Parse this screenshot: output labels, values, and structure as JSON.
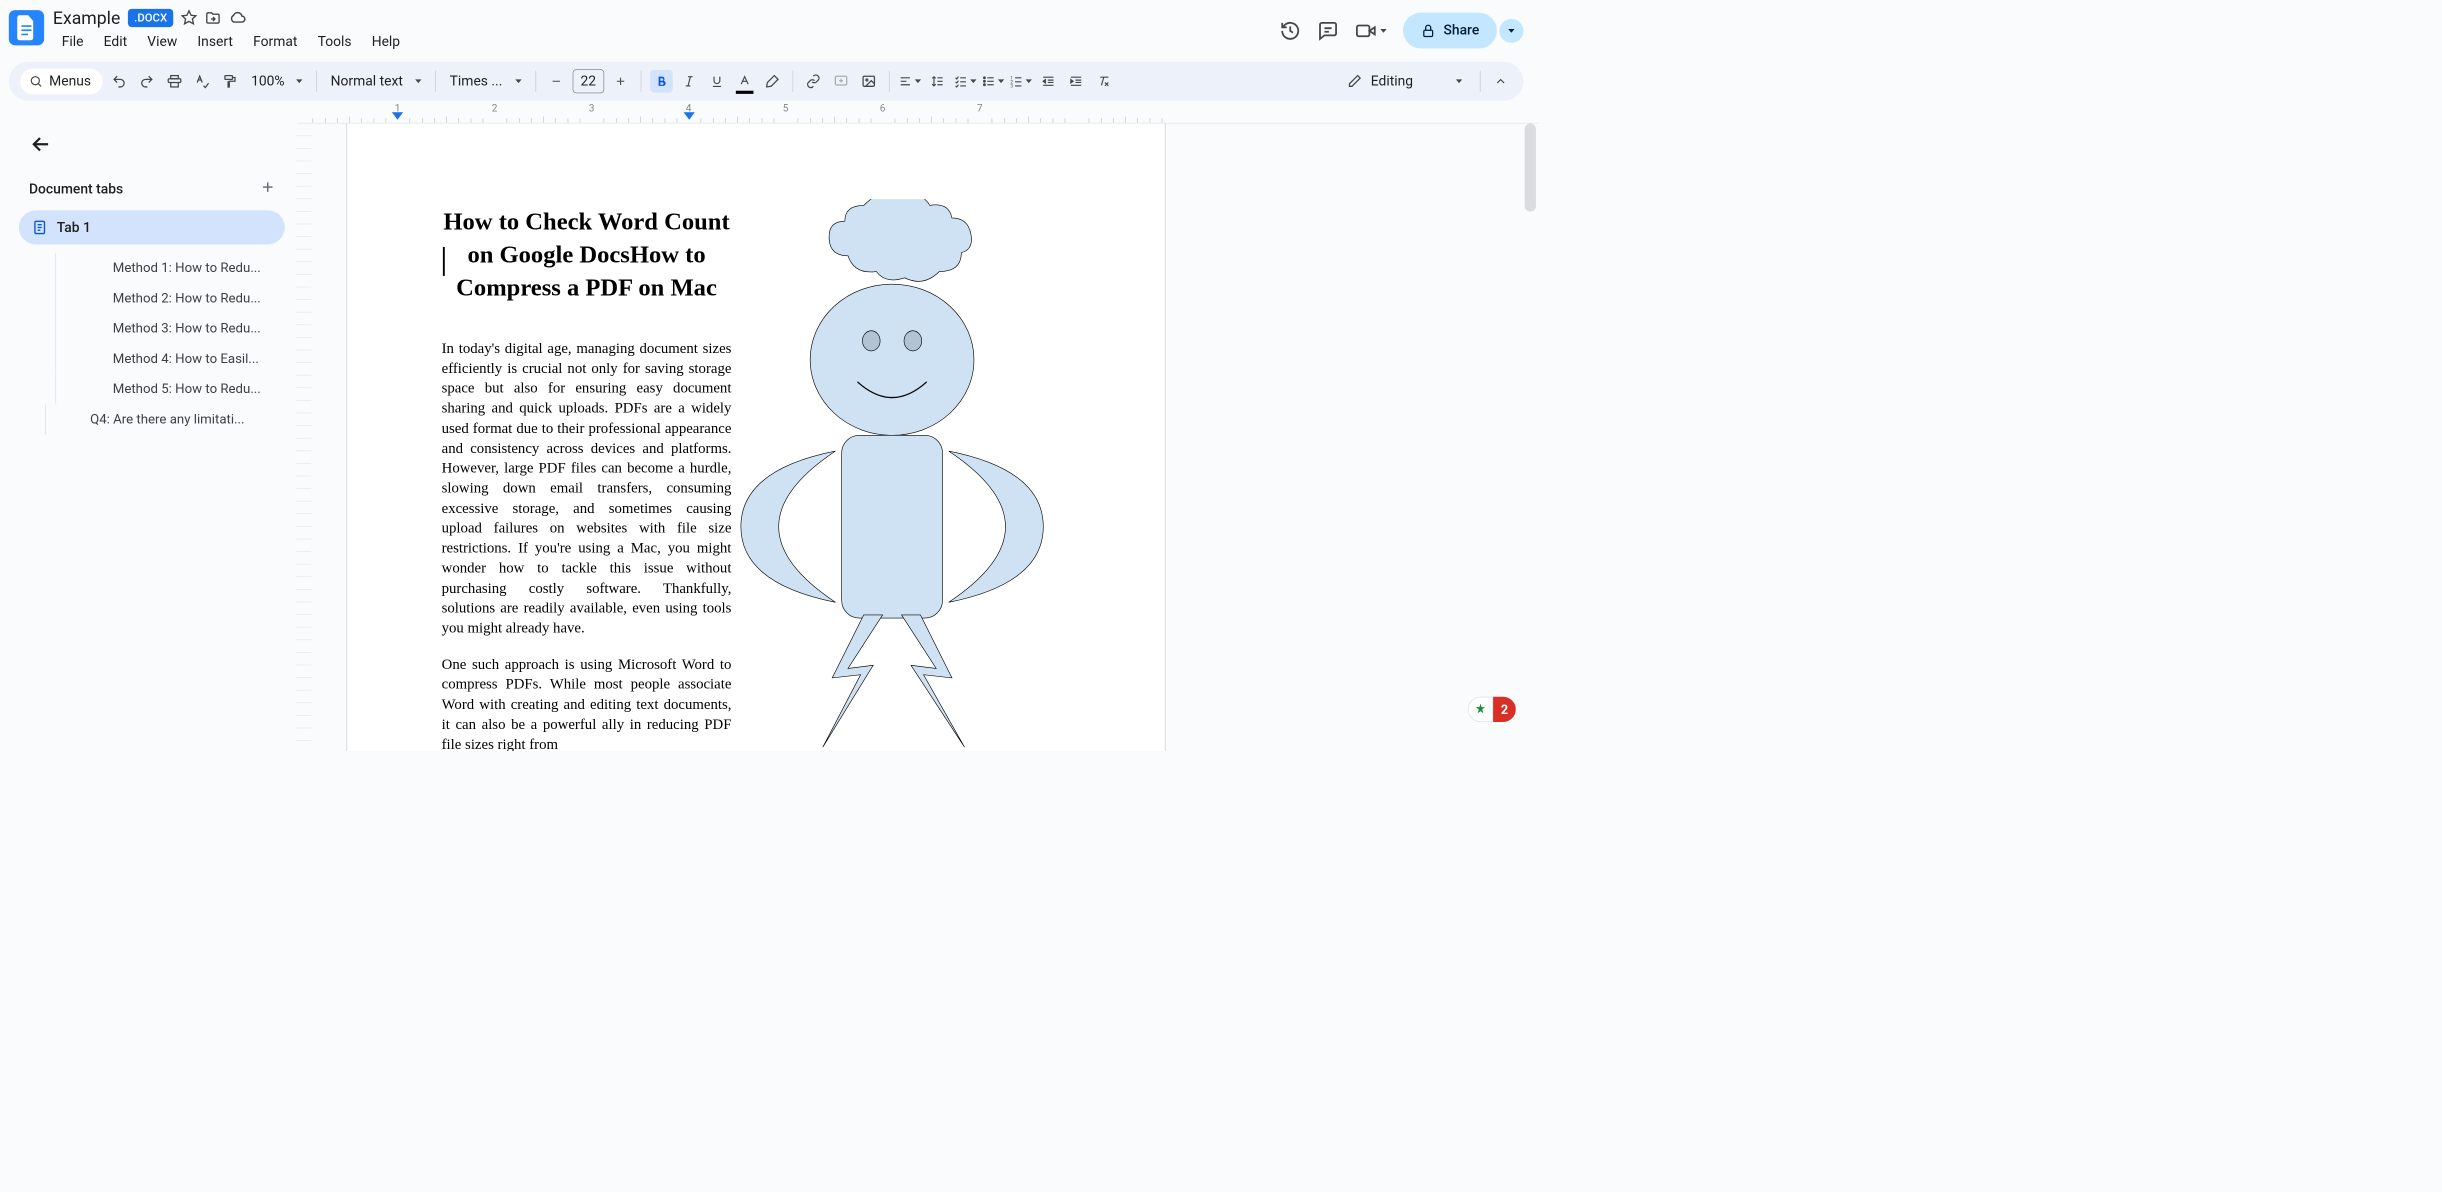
{
  "header": {
    "doc_title": "Example",
    "docx_badge": ".DOCX",
    "menus": [
      "File",
      "Edit",
      "View",
      "Insert",
      "Format",
      "Tools",
      "Help"
    ],
    "share_label": "Share"
  },
  "toolbar": {
    "menus_label": "Menus",
    "zoom": "100%",
    "style": "Normal text",
    "font": "Times ...",
    "font_size": "22",
    "editing_label": "Editing"
  },
  "ruler": {
    "numbers": [
      "1",
      "2",
      "3",
      "4",
      "5",
      "6",
      "7"
    ]
  },
  "sidebar": {
    "tabs_header": "Document tabs",
    "active_tab": "Tab 1",
    "outline": [
      "Method 1: How to Redu...",
      "Method 2: How to Redu...",
      "Method 3: How to Redu...",
      "Method 4: How to Easil...",
      "Method 5: How to Redu...",
      "Q4: Are there any limitati..."
    ]
  },
  "document": {
    "heading": "How to Check Word Count on Google DocsHow to Compress a PDF on Mac",
    "para1": "In today's digital age, managing document sizes efficiently is crucial not only for saving storage space but also for ensuring easy document sharing and quick uploads. PDFs are a widely used format due to their professional appearance and consistency across devices and platforms. However, large PDF files can become a hurdle, slowing down email transfers, consuming excessive storage, and sometimes causing upload failures on websites with file size restrictions. If you're using a Mac, you might wonder how to tackle this issue without purchasing costly software. Thankfully, solutions are readily available, even using tools you might already have.",
    "para2": "One such approach is using Microsoft Word to compress PDFs. While most people associate Word with creating and editing text documents, it can also be a powerful ally in reducing PDF file sizes right from"
  },
  "figure": {
    "fill": "#cfe2f3",
    "stroke": "#000000"
  },
  "fab": {
    "count": "2"
  }
}
